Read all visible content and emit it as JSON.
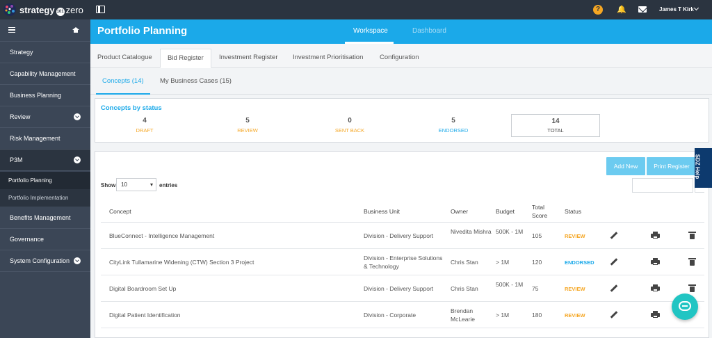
{
  "topbar": {
    "brand_start": "strategy",
    "brand_mid": "101",
    "brand_end": "zero",
    "help_icon": "?",
    "bell_icon": "🔔",
    "user_name": "James T Kirk"
  },
  "sidebar": {
    "items": [
      {
        "label": "Strategy"
      },
      {
        "label": "Capability Management"
      },
      {
        "label": "Business Planning"
      },
      {
        "label": "Review"
      },
      {
        "label": "Risk Management"
      },
      {
        "label": "P3M"
      },
      {
        "label": "Benefits Management"
      },
      {
        "label": "Governance"
      },
      {
        "label": "System Configuration"
      }
    ],
    "sub_items": [
      {
        "label": "Portfolio Planning"
      },
      {
        "label": "Portfolio Implementation"
      }
    ]
  },
  "header": {
    "title": "Portfolio Planning",
    "tabs": [
      {
        "label": "Workspace"
      },
      {
        "label": "Dashboard"
      }
    ]
  },
  "register_tabs": [
    {
      "label": "Product Catalogue"
    },
    {
      "label": "Bid Register"
    },
    {
      "label": "Investment Register"
    },
    {
      "label": "Investment Prioritisation"
    },
    {
      "label": "Configuration"
    }
  ],
  "sub_tabs": [
    {
      "label": "Concepts (14)"
    },
    {
      "label": "My Business Cases (15)"
    }
  ],
  "status": {
    "title": "Concepts by status",
    "items": [
      {
        "count": "4",
        "label": "DRAFT",
        "color": "#f5a623"
      },
      {
        "count": "5",
        "label": "REVIEW",
        "color": "#f5a623"
      },
      {
        "count": "0",
        "label": "SENT BACK",
        "color": "#f5a623"
      },
      {
        "count": "5",
        "label": "ENDORSED",
        "color": "#1ba9e9"
      },
      {
        "count": "14",
        "label": "TOTAL",
        "color": "#444444"
      }
    ]
  },
  "table": {
    "add_button": "Add New",
    "print_button": "Print Register",
    "show_label": "Show",
    "page_size": "10",
    "entries_label": "entries",
    "columns": {
      "concept": "Concept",
      "business_unit": "Business Unit",
      "owner": "Owner",
      "budget": "Budget",
      "total_score": "Total Score",
      "status": "Status"
    },
    "rows": [
      {
        "concept": "BlueConnect - Intelligence Management",
        "business_unit": "Division - Delivery Support",
        "owner": "Nivedita Mishra",
        "budget": "500K - 1M",
        "score": "105",
        "status": "REVIEW"
      },
      {
        "concept": "CityLink Tullamarine Widening (CTW) Section 3 Project",
        "business_unit": "Division - Enterprise Solutions & Technology",
        "owner": "Chris Stan",
        "budget": "> 1M",
        "score": "120",
        "status": "ENDORSED"
      },
      {
        "concept": "Digital Boardroom Set Up",
        "business_unit": "Division - Delivery Support",
        "owner": "Chris Stan",
        "budget": "500K - 1M",
        "score": "75",
        "status": "REVIEW"
      },
      {
        "concept": "Digital Patient Identification",
        "business_unit": "Division - Corporate",
        "owner": "Brendan McLearie",
        "budget": "> 1M",
        "score": "180",
        "status": "REVIEW"
      }
    ]
  },
  "help_tab": "SDZ Help",
  "colors": {
    "accent": "#1ba9e9",
    "review": "#f5a623",
    "endorsed": "#1ba9e9",
    "sidebar": "#3b4656",
    "topbar": "#2b3440",
    "chat": "#21c5c3"
  }
}
